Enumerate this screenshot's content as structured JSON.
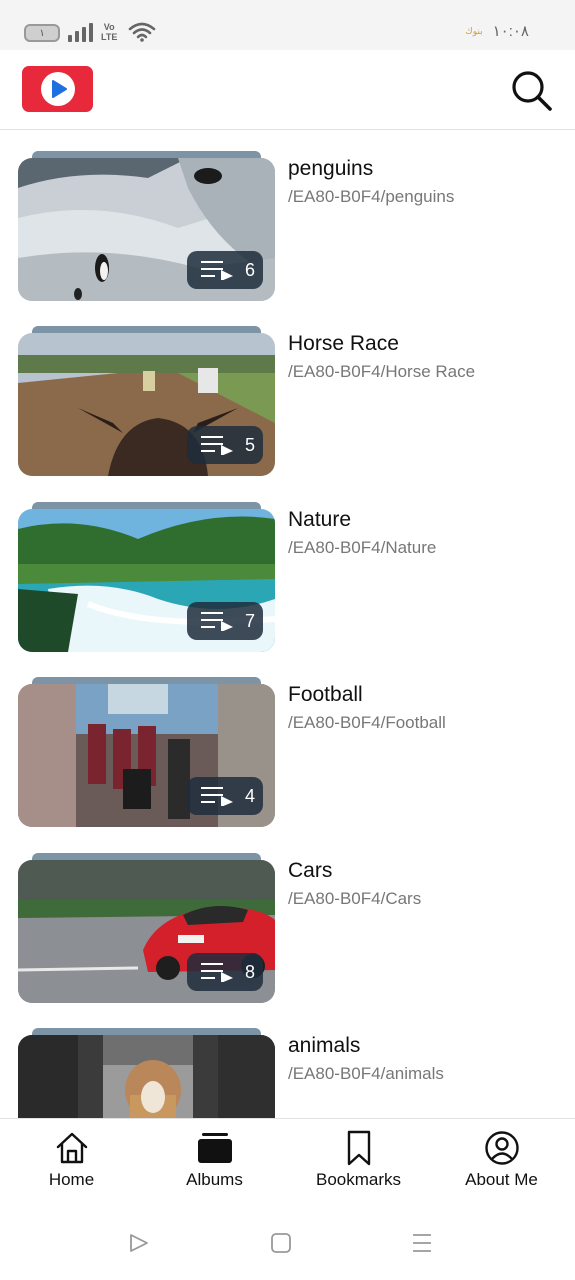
{
  "status_bar": {
    "battery_level": "١",
    "network": "Vo LTE",
    "time": "١٠:٠٨",
    "badge": "بنوك"
  },
  "header": {
    "logo_icon": "play-logo-icon",
    "search_icon": "search-icon"
  },
  "albums": [
    {
      "title": "penguins",
      "path": "/EA80-B0F4/penguins",
      "count": "6"
    },
    {
      "title": "Horse Race",
      "path": "/EA80-B0F4/Horse Race",
      "count": "5"
    },
    {
      "title": "Nature",
      "path": "/EA80-B0F4/Nature",
      "count": "7"
    },
    {
      "title": "Football",
      "path": "/EA80-B0F4/Football",
      "count": "4"
    },
    {
      "title": "Cars",
      "path": "/EA80-B0F4/Cars",
      "count": "8"
    },
    {
      "title": "animals",
      "path": "/EA80-B0F4/animals",
      "count": ""
    }
  ],
  "bottom_nav": {
    "home": "Home",
    "albums": "Albums",
    "bookmarks": "Bookmarks",
    "about": "About Me"
  },
  "colors": {
    "brand_red": "#e8283b",
    "brand_blue": "#1f6fe0",
    "count_pill": "#1e2d3c"
  }
}
